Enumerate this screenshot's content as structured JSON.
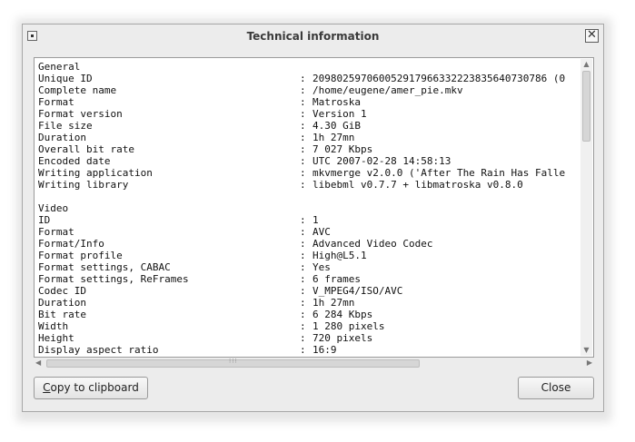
{
  "window": {
    "title": "Technical information",
    "close_glyph": "✕",
    "menu_icon": "window-menu-icon"
  },
  "info": {
    "general_header": "General",
    "general": [
      {
        "key": "Unique ID",
        "value": "209802597060052917966332223835640730786 (0"
      },
      {
        "key": "Complete name",
        "value": "/home/eugene/amer_pie.mkv"
      },
      {
        "key": "Format",
        "value": "Matroska"
      },
      {
        "key": "Format version",
        "value": "Version 1"
      },
      {
        "key": "File size",
        "value": "4.30 GiB"
      },
      {
        "key": "Duration",
        "value": "1h 27mn"
      },
      {
        "key": "Overall bit rate",
        "value": "7 027 Kbps"
      },
      {
        "key": "Encoded date",
        "value": "UTC 2007-02-28 14:58:13"
      },
      {
        "key": "Writing application",
        "value": "mkvmerge v2.0.0 ('After The Rain Has Falle"
      },
      {
        "key": "Writing library",
        "value": "libebml v0.7.7 + libmatroska v0.8.0"
      }
    ],
    "video_header": "Video",
    "video": [
      {
        "key": "ID",
        "value": "1"
      },
      {
        "key": "Format",
        "value": "AVC"
      },
      {
        "key": "Format/Info",
        "value": "Advanced Video Codec"
      },
      {
        "key": "Format profile",
        "value": "High@L5.1"
      },
      {
        "key": "Format settings, CABAC",
        "value": "Yes"
      },
      {
        "key": "Format settings, ReFrames",
        "value": "6 frames"
      },
      {
        "key": "Codec ID",
        "value": "V_MPEG4/ISO/AVC"
      },
      {
        "key": "Duration",
        "value": "1h 27mn"
      },
      {
        "key": "Bit rate",
        "value": "6 284 Kbps"
      },
      {
        "key": "Width",
        "value": "1 280 pixels"
      },
      {
        "key": "Height",
        "value": "720 pixels"
      },
      {
        "key": "Display aspect ratio",
        "value": "16:9"
      }
    ],
    "separator": ":"
  },
  "buttons": {
    "copy_mnemonic": "C",
    "copy_rest": "opy to clipboard",
    "close": "Close"
  }
}
